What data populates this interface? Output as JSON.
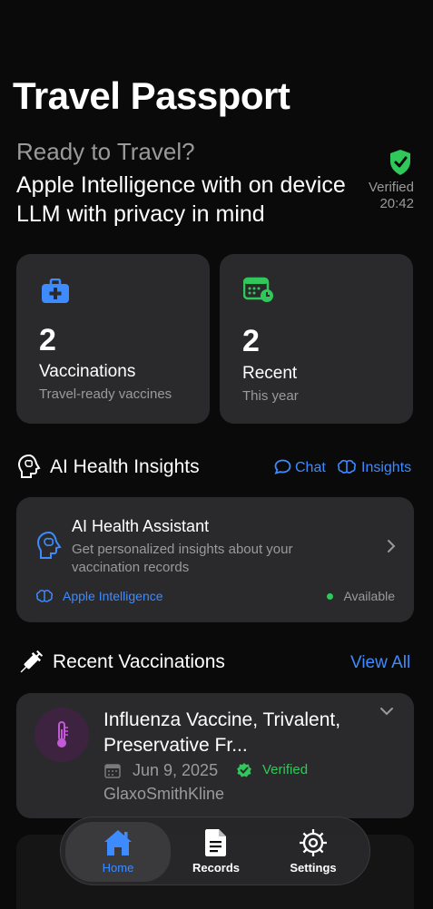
{
  "header": {
    "title": "Travel Passport",
    "subtitle": "Ready to Travel?",
    "tagline": "Apple Intelligence with on device LLM with privacy in mind",
    "verified_label": "Verified",
    "verified_time": "20:42"
  },
  "stats": [
    {
      "icon": "medical-bag-icon",
      "value": "2",
      "label": "Vaccinations",
      "sub": "Travel-ready vaccines"
    },
    {
      "icon": "calendar-clock-icon",
      "value": "2",
      "label": "Recent",
      "sub": "This year"
    }
  ],
  "insights": {
    "title": "AI Health Insights",
    "chat_label": "Chat",
    "insights_label": "Insights",
    "assistant_title": "AI Health Assistant",
    "assistant_desc": "Get personalized insights about your vaccination records",
    "brand": "Apple Intelligence",
    "status": "Available"
  },
  "recent": {
    "title": "Recent Vaccinations",
    "view_all": "View All",
    "items": [
      {
        "name": "Influenza Vaccine, Trivalent, Preservative Fr...",
        "date": "Jun 9, 2025",
        "status": "Verified",
        "manufacturer": "GlaxoSmithKline"
      }
    ]
  },
  "tabs": [
    {
      "label": "Home",
      "icon": "house-icon",
      "active": true
    },
    {
      "label": "Records",
      "icon": "document-icon",
      "active": false
    },
    {
      "label": "Settings",
      "icon": "gear-icon",
      "active": false
    }
  ],
  "colors": {
    "accent": "#3d8bff",
    "success": "#30c85a",
    "card": "#2a2a2c",
    "background": "#0a0a0a"
  }
}
